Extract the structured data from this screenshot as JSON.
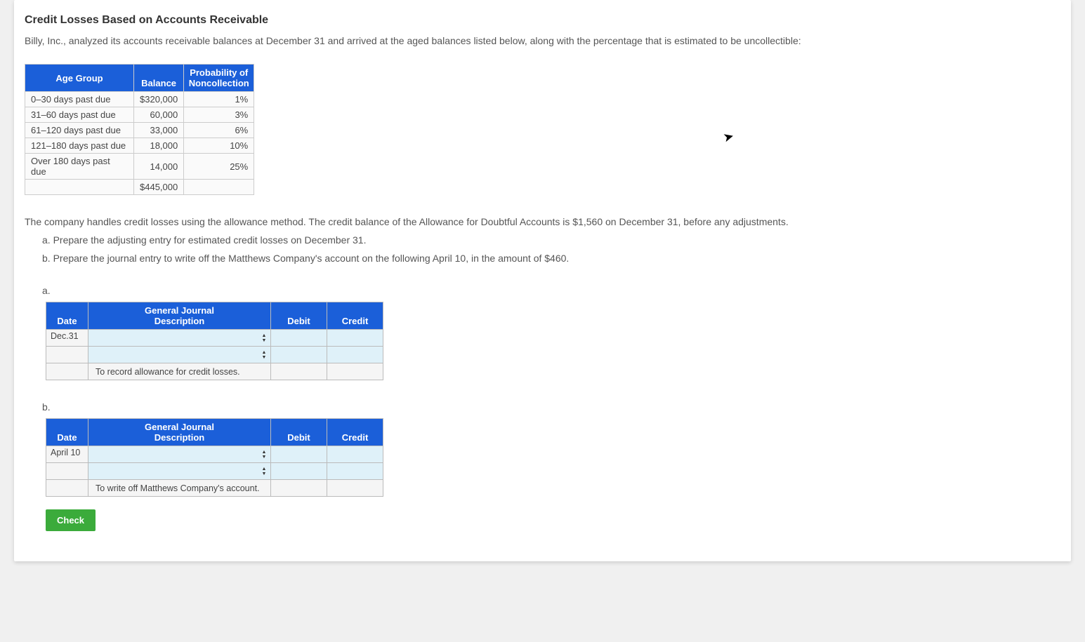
{
  "title": "Credit Losses Based on Accounts Receivable",
  "intro": "Billy, Inc., analyzed its accounts receivable balances at December 31 and arrived at the aged balances listed below, along with the percentage that is estimated to be uncollectible:",
  "age_table": {
    "headers": {
      "group": "Age Group",
      "balance": "Balance",
      "prob": "Probability of Noncollection"
    },
    "rows": [
      {
        "group": "0–30 days past due",
        "balance": "$320,000",
        "prob": "1%"
      },
      {
        "group": "31–60 days past due",
        "balance": "60,000",
        "prob": "3%"
      },
      {
        "group": "61–120 days past due",
        "balance": "33,000",
        "prob": "6%"
      },
      {
        "group": "121–180 days past due",
        "balance": "18,000",
        "prob": "10%"
      },
      {
        "group": "Over 180 days past due",
        "balance": "14,000",
        "prob": "25%"
      }
    ],
    "total": "$445,000"
  },
  "body1": "The company handles credit losses using the allowance method. The credit balance of the Allowance for Doubtful Accounts is $1,560 on December 31, before any adjustments.",
  "q_a": "a. Prepare the adjusting entry for estimated credit losses on December 31.",
  "q_b": "b. Prepare the journal entry to write off the Matthews Company's account on the following April 10, in the amount of $460.",
  "label_a": "a.",
  "label_b": "b.",
  "journal_headers": {
    "top": "General Journal",
    "date": "Date",
    "desc": "Description",
    "debit": "Debit",
    "credit": "Credit"
  },
  "journal_a": {
    "date": "Dec.31",
    "memo": "To record allowance for credit losses."
  },
  "journal_b": {
    "date": "April 10",
    "memo": "To write off Matthews Company's account."
  },
  "check_label": "Check"
}
